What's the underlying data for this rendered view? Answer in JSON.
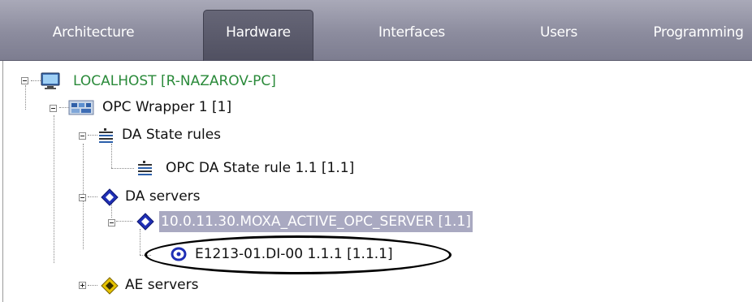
{
  "tabs": [
    {
      "label": "Architecture",
      "active": false
    },
    {
      "label": "Hardware",
      "active": true
    },
    {
      "label": "Interfaces",
      "active": false
    },
    {
      "label": "Users",
      "active": false
    },
    {
      "label": "Programming",
      "active": false
    }
  ],
  "tree": {
    "root": "LOCALHOST [R-NAZAROV-PC]",
    "opc_wrapper": "OPC Wrapper 1 [1]",
    "da_state_rules": "DA State rules",
    "da_state_rule": "OPC DA State rule 1.1 [1.1]",
    "da_servers": "DA servers",
    "da_server": "10.0.11.30.MOXA_ACTIVE_OPC_SERVER [1.1]",
    "da_item": "E1213-01.DI-00 1.1.1 [1.1.1]",
    "ae_servers": "AE servers"
  },
  "icons": {
    "root": "computer-icon",
    "opc_wrapper": "opc-wrapper-icon",
    "da_state_rules": "state-rules-icon",
    "da_state_rule": "state-rule-icon",
    "da_servers": "da-servers-icon",
    "da_server": "da-server-icon",
    "da_item": "da-item-icon",
    "ae_servers": "ae-servers-icon"
  },
  "colors": {
    "tabbar": "#8c8c9e",
    "active_tab": "#5a5a6b",
    "selection": "#a9a9c1",
    "root_text": "#2a8a3a",
    "diamond_blue": "#1f2fb5",
    "diamond_yellow": "#e6c200"
  }
}
